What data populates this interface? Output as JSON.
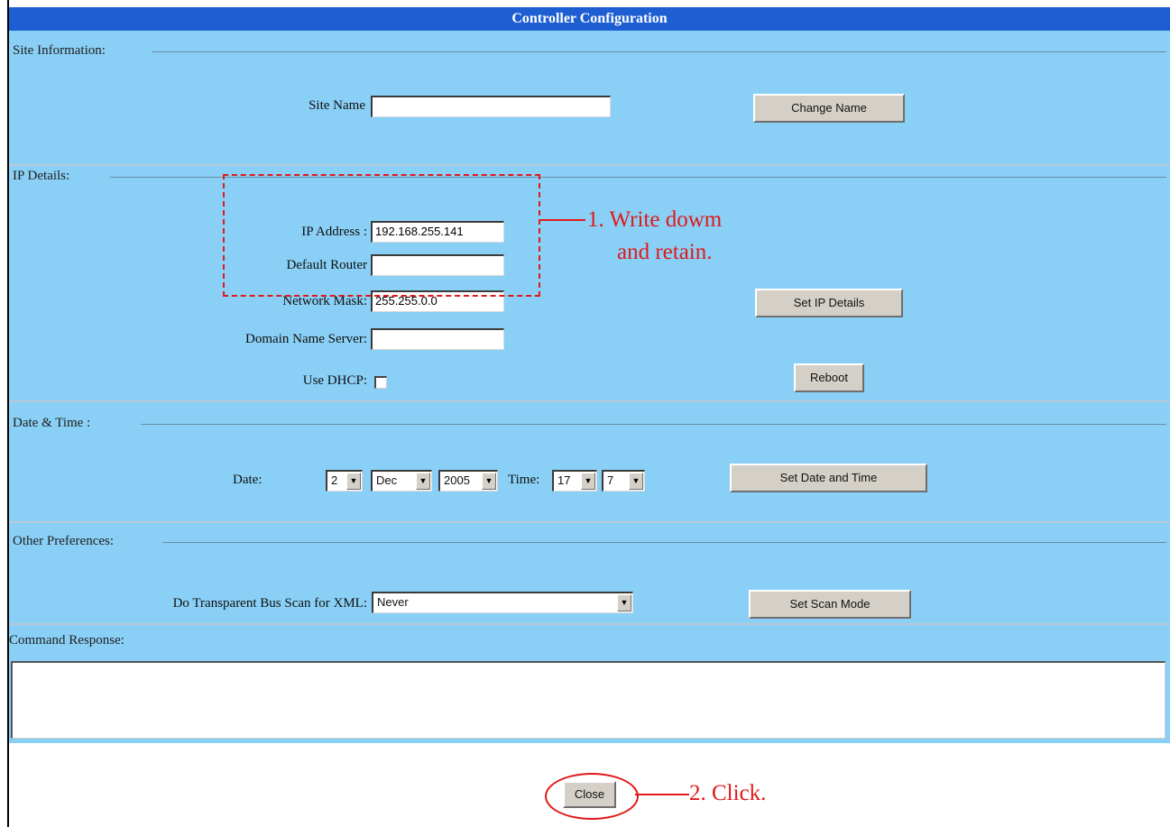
{
  "window": {
    "title": "Controller Configuration"
  },
  "site_info": {
    "section_label": "Site Information:",
    "site_name_label": "Site Name",
    "site_name_value": "",
    "change_name_button": "Change Name"
  },
  "ip_details": {
    "section_label": "IP Details:",
    "ip_address_label": "IP Address :",
    "ip_address_value": "192.168.255.141",
    "default_router_label": "Default Router",
    "default_router_value": "",
    "network_mask_label": "Network Mask:",
    "network_mask_value": "255.255.0.0",
    "dns_label": "Domain Name Server:",
    "dns_value": "",
    "dhcp_label": "Use DHCP:",
    "dhcp_checked": false,
    "set_ip_button": "Set IP Details",
    "reboot_button": "Reboot"
  },
  "date_time": {
    "section_label": "Date & Time :",
    "date_label": "Date:",
    "day_value": "2",
    "month_value": "Dec",
    "year_value": "2005",
    "time_label": "Time:",
    "hour_value": "17",
    "minute_value": "7",
    "set_button": "Set Date and Time"
  },
  "preferences": {
    "section_label": "Other Preferences:",
    "scan_label": "Do Transparent Bus Scan for XML:",
    "scan_value": "Never",
    "set_scan_button": "Set Scan Mode"
  },
  "command_response": {
    "label": "Command Response:",
    "value": ""
  },
  "footer": {
    "close_button": "Close"
  },
  "annotations": {
    "note1_line1": "1. Write dowm",
    "note1_line2": "and retain.",
    "note2": "2. Click."
  },
  "colors": {
    "panel": "#8ad0f6",
    "titlebar": "#1d5fd2",
    "annotation": "#e01919"
  }
}
